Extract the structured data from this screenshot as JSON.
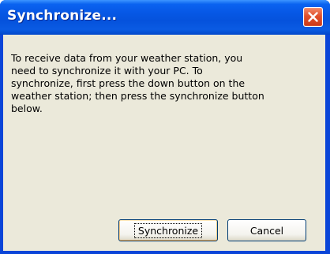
{
  "window": {
    "title": "Synchronize..."
  },
  "message": "To receive data from your weather station, you\nneed to synchronize it with your PC. To\nsynchronize, first press the down button on the\nweather station; then press the synchronize button\nbelow.",
  "buttons": {
    "synchronize_label": "Synchronize",
    "cancel_label": "Cancel"
  },
  "icons": {
    "close": "close-icon"
  },
  "colors": {
    "title_bar": "#0758e6",
    "client_area": "#ebe9da",
    "close_button": "#e1502c"
  }
}
